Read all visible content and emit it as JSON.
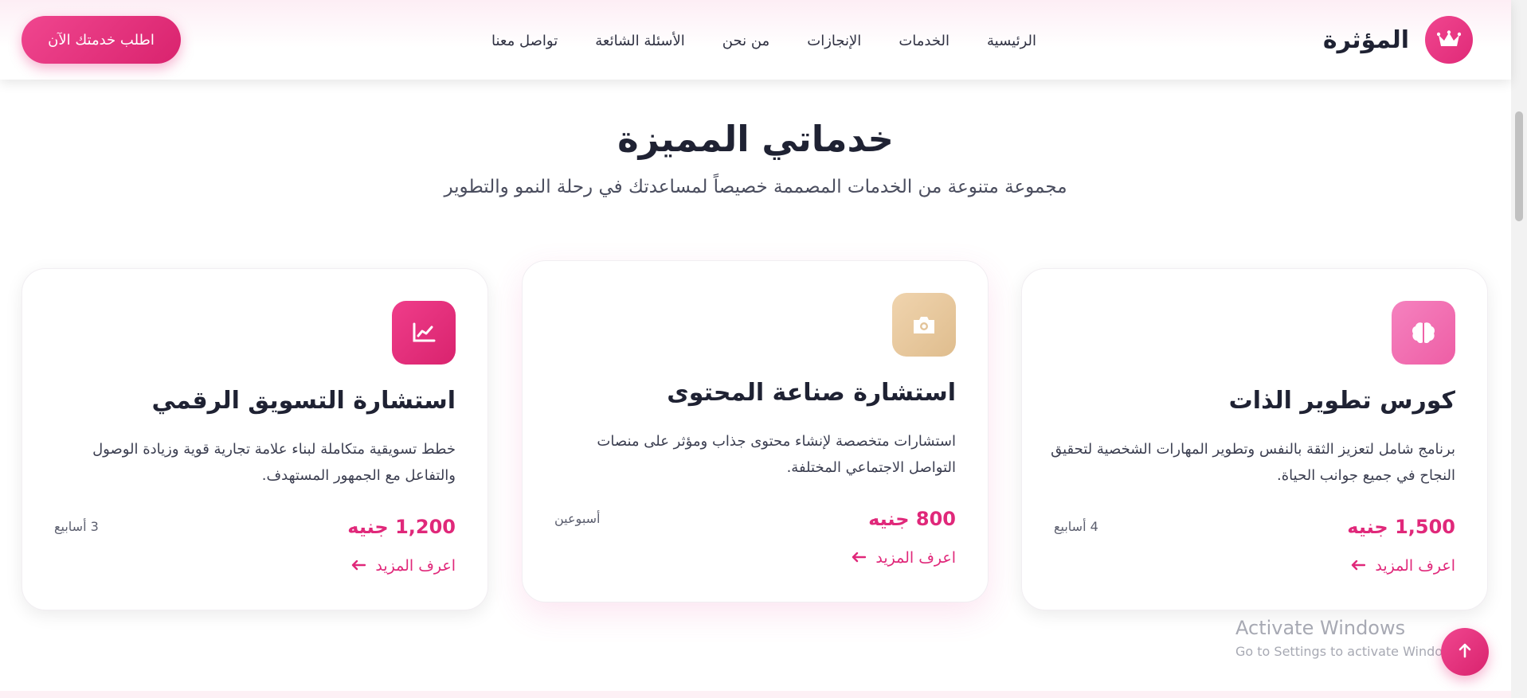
{
  "brand": {
    "name": "المؤثرة",
    "logo_icon": "crown-icon"
  },
  "nav": {
    "items": [
      "الرئيسية",
      "الخدمات",
      "الإنجازات",
      "من نحن",
      "الأسئلة الشائعة",
      "تواصل معنا"
    ],
    "cta_label": "اطلب خدمتك الآن"
  },
  "section": {
    "title": "خدماتي المميزة",
    "subtitle": "مجموعة متنوعة من الخدمات المصممة خصيصاً لمساعدتك في رحلة النمو والتطوير"
  },
  "cards": [
    {
      "icon": "brain-icon",
      "icon_color": "#f472b6",
      "title": "كورس تطوير الذات",
      "desc": "برنامج شامل لتعزيز الثقة بالنفس وتطوير المهارات الشخصية لتحقيق النجاح في جميع جوانب الحياة.",
      "price": "1,500 جنيه",
      "duration": "4 أسابيع",
      "more": "اعرف المزيد"
    },
    {
      "icon": "camera-icon",
      "icon_color": "#e8c9a0",
      "title": "استشارة صناعة المحتوى",
      "desc": "استشارات متخصصة لإنشاء محتوى جذاب ومؤثر على منصات التواصل الاجتماعي المختلفة.",
      "price": "800 جنيه",
      "duration": "أسبوعين",
      "more": "اعرف المزيد"
    },
    {
      "icon": "chart-line-icon",
      "icon_color": "#e0287a",
      "title": "استشارة التسويق الرقمي",
      "desc": "خطط تسويقية متكاملة لبناء علامة تجارية قوية وزيادة الوصول والتفاعل مع الجمهور المستهدف.",
      "price": "1,200 جنيه",
      "duration": "3 أسابيع",
      "more": "اعرف المزيد"
    }
  ],
  "watermark": {
    "title": "Activate Windows",
    "subtitle": "Go to Settings to activate Windows."
  },
  "colors": {
    "accent": "#e0287a",
    "text": "#1f2233"
  }
}
